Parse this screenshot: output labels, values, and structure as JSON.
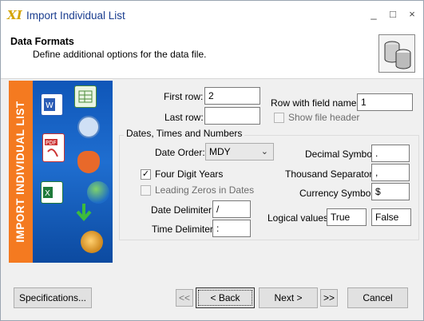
{
  "window": {
    "title": "Import Individual List",
    "app_icon": "XI",
    "controls": [
      "_",
      "□",
      "×"
    ]
  },
  "header": {
    "title": "Data Formats",
    "subtitle": "Define additional options for the data file.",
    "icon": "database-icon"
  },
  "sidebar": {
    "banner": "IMPORT INDIVIDUAL LIST"
  },
  "rows": {
    "first_row_label": "First row:",
    "first_row_value": "2",
    "last_row_label": "Last row:",
    "last_row_value": "",
    "field_names_label": "Row with field names:",
    "field_names_value": "1",
    "show_header_label": "Show file header"
  },
  "dates": {
    "group_title": "Dates, Times and Numbers",
    "date_order_label": "Date Order:",
    "date_order_value": "MDY",
    "four_digit_label": "Four Digit Years",
    "leading_zeros_label": "Leading Zeros in Dates",
    "date_delim_label": "Date Delimiter:",
    "date_delim_value": "/",
    "time_delim_label": "Time Delimiter:",
    "time_delim_value": ":",
    "decimal_label": "Decimal Symbol:",
    "decimal_value": ".",
    "thousand_label": "Thousand Separator:",
    "thousand_value": ",",
    "currency_label": "Currency Symbol:",
    "currency_value": "$",
    "logical_label": "Logical values:",
    "logical_true": "True",
    "logical_false": "False"
  },
  "buttons": {
    "specifications": "Specifications...",
    "first": "<<",
    "back": "< Back",
    "next": "Next >",
    "last": ">>",
    "cancel": "Cancel"
  }
}
